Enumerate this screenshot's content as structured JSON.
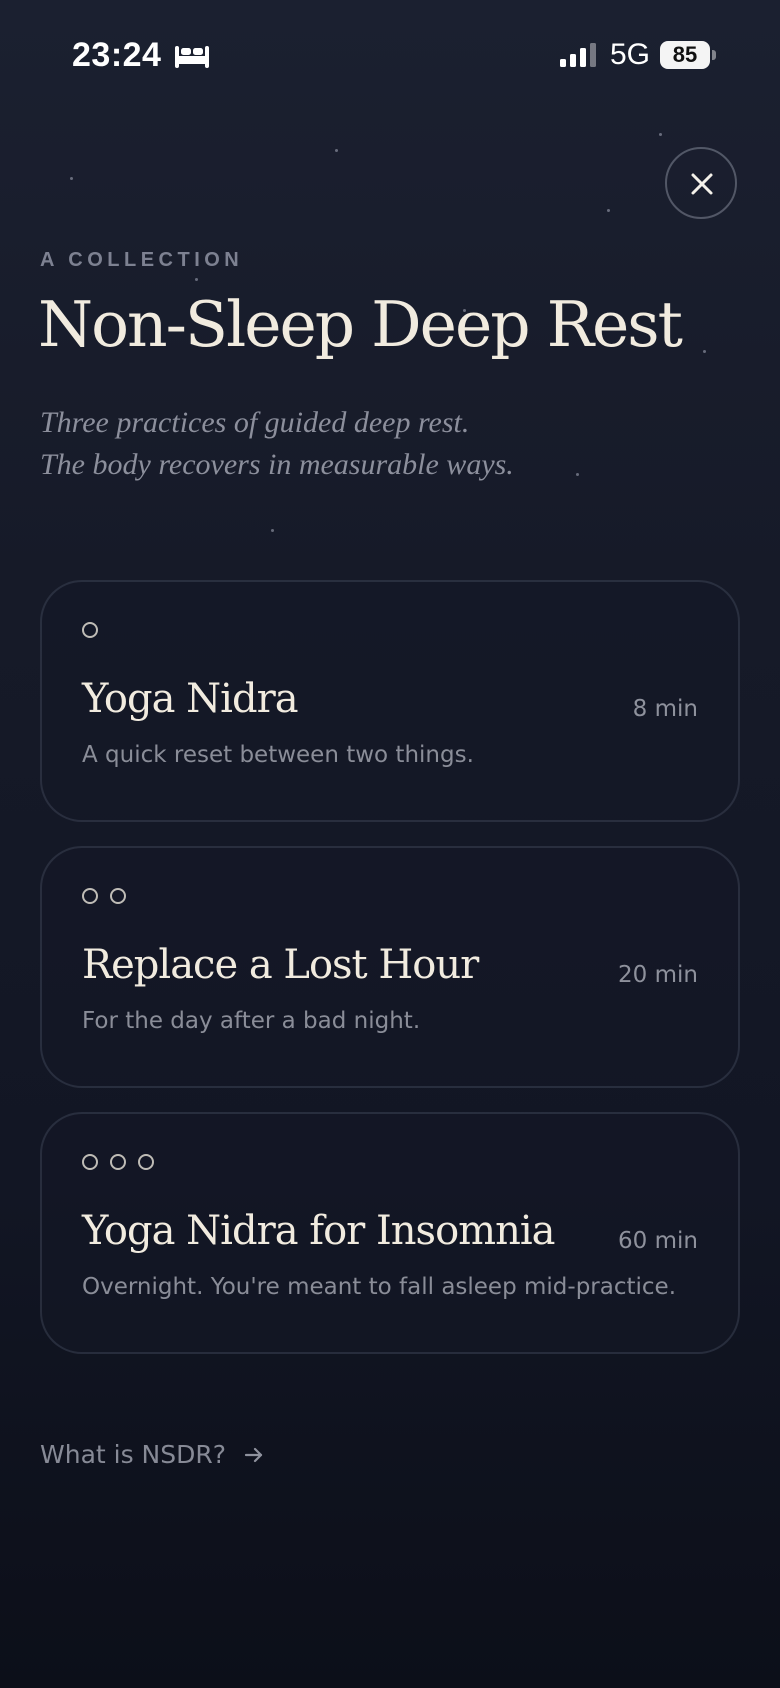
{
  "status_bar": {
    "time": "23:24",
    "network": "5G",
    "battery": "85"
  },
  "header": {
    "eyebrow": "A COLLECTION",
    "title": "Non-Sleep Deep Rest",
    "subtitle_lines": [
      "Three practices of guided deep rest.",
      "The body recovers in measurable ways."
    ]
  },
  "practices": [
    {
      "level": 1,
      "title": "Yoga Nidra",
      "duration": "8 min",
      "description": "A quick reset between two things."
    },
    {
      "level": 2,
      "title": "Replace a Lost Hour",
      "duration": "20 min",
      "description": "For the day after a bad night."
    },
    {
      "level": 3,
      "title": "Yoga Nidra for Insomnia",
      "duration": "60 min",
      "description": "Overnight. You're meant to fall asleep mid-practice."
    }
  ],
  "footer": {
    "link_label": "What is NSDR?"
  },
  "icons": {
    "close": "close-icon",
    "bed": "bed-icon",
    "signal": "signal-icon",
    "arrow": "arrow-right-icon",
    "level_dot": "circle-outline-icon"
  },
  "colors": {
    "background_top": "#1b2030",
    "background_bottom": "#0c0f19",
    "title_text": "#f1ebdf",
    "muted_text": "#8a8d98",
    "card_border": "#2a3042"
  }
}
